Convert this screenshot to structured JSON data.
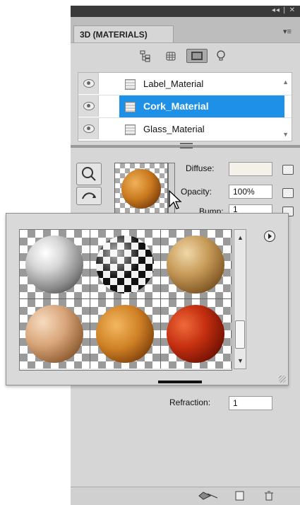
{
  "window": {
    "controls": "◂◂ | ✕"
  },
  "tab": {
    "label": "3D (MATERIALS)",
    "menu_icon": "panel-menu-icon"
  },
  "toolbar": {
    "icons": [
      "scene-icon",
      "mesh-icon",
      "materials-icon",
      "light-icon"
    ]
  },
  "materials": [
    {
      "name": "Label_Material",
      "selected": false
    },
    {
      "name": "Cork_Material",
      "selected": true
    },
    {
      "name": "Glass_Material",
      "selected": false
    }
  ],
  "properties": {
    "diffuse_label": "Diffuse:",
    "opacity_label": "Opacity:",
    "opacity_value": "100%",
    "bump_label": "Bump:",
    "bump_value": "1",
    "refraction_label": "Refraction:",
    "refraction_value": "1"
  },
  "preset_swatches": [
    "chrome",
    "checkerboard",
    "stone",
    "wood",
    "cork",
    "red-plastic"
  ],
  "colors": {
    "selection": "#1e90e8",
    "panel": "#d6d6d6"
  }
}
